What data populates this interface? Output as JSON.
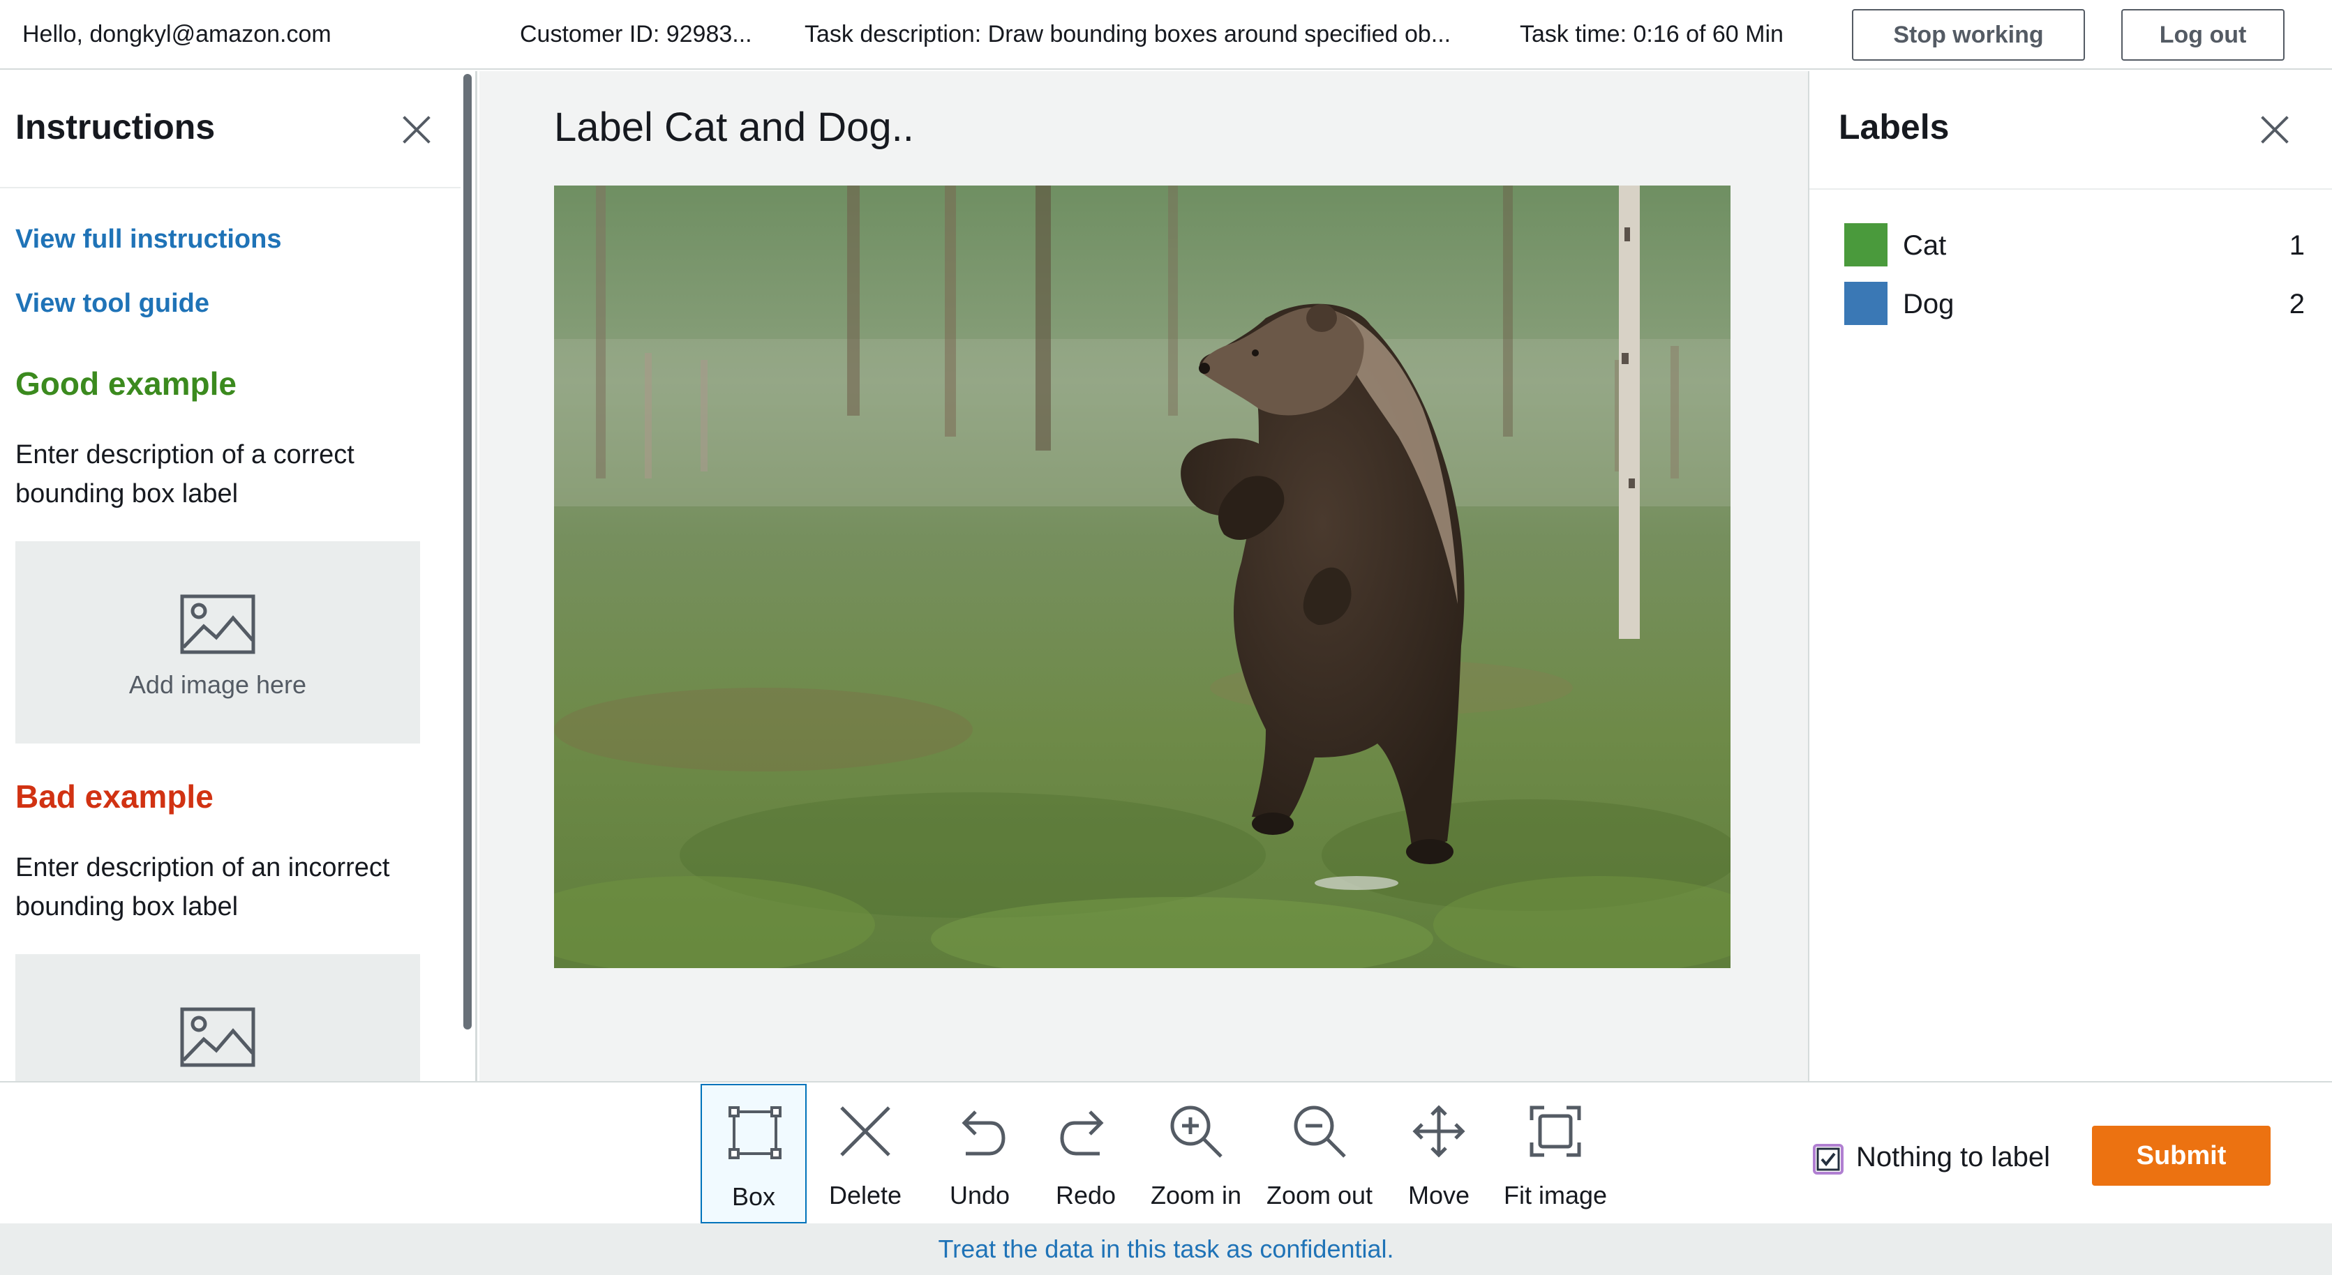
{
  "header": {
    "greeting": "Hello, dongkyl@amazon.com",
    "customer_id": "Customer ID: 92983...",
    "task_description": "Task description: Draw bounding boxes around specified ob...",
    "task_time": "Task time: 0:16 of 60 Min",
    "stop_working_label": "Stop working",
    "logout_label": "Log out"
  },
  "instructions": {
    "title": "Instructions",
    "view_full_instructions": "View full instructions",
    "view_tool_guide": "View tool guide",
    "good_example_heading": "Good example",
    "good_example_description": "Enter description of a correct bounding box label",
    "good_example_placeholder": "Add image here",
    "bad_example_heading": "Bad example",
    "bad_example_description": "Enter description of an incorrect bounding box label",
    "good_color": "#3b8a1e",
    "bad_color": "#d13212"
  },
  "canvas": {
    "task_title": "Label Cat and Dog..",
    "image_subject": "brown bear standing in grassy forest"
  },
  "labels": {
    "title": "Labels",
    "items": [
      {
        "name": "Cat",
        "count": "1",
        "color": "#4a9a3c"
      },
      {
        "name": "Dog",
        "count": "2",
        "color": "#3a78b5"
      }
    ]
  },
  "toolbar": {
    "tools": [
      {
        "label": "Box",
        "icon": "box-icon",
        "active": true
      },
      {
        "label": "Delete",
        "icon": "x-icon",
        "active": false
      },
      {
        "label": "Undo",
        "icon": "undo-icon",
        "active": false
      },
      {
        "label": "Redo",
        "icon": "redo-icon",
        "active": false
      },
      {
        "label": "Zoom in",
        "icon": "zoom-in-icon",
        "active": false
      },
      {
        "label": "Zoom out",
        "icon": "zoom-out-icon",
        "active": false
      },
      {
        "label": "Move",
        "icon": "move-icon",
        "active": false
      },
      {
        "label": "Fit image",
        "icon": "fit-image-icon",
        "active": false
      }
    ],
    "nothing_to_label": "Nothing to label",
    "nothing_to_label_checked": true,
    "submit_label": "Submit",
    "submit_color": "#ec7211"
  },
  "footer": {
    "notice": "Treat the data in this task as confidential."
  }
}
